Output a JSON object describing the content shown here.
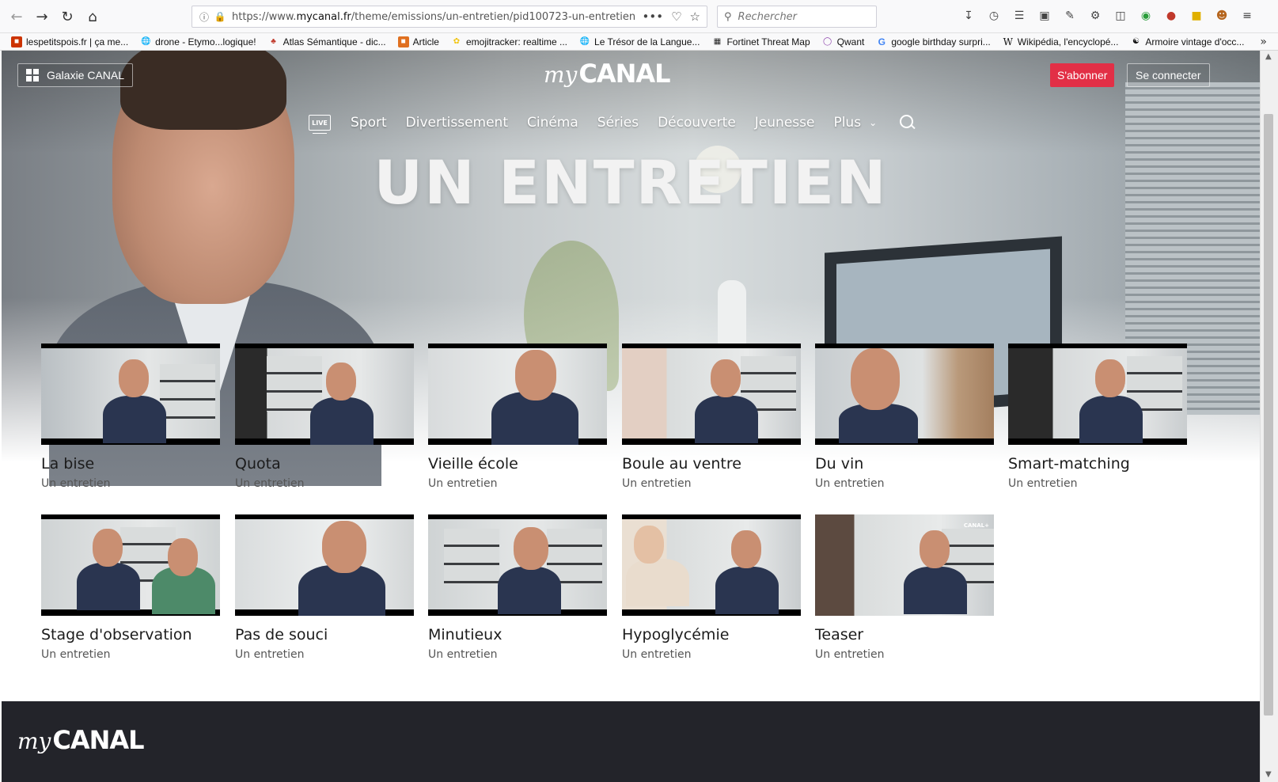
{
  "browser": {
    "url_prefix": "https://www.",
    "url_host": "mycanal.fr",
    "url_path": "/theme/emissions/un-entretien/pid100723-un-entretien",
    "search_placeholder": "Rechercher",
    "more_actions": "•••",
    "bookmarks": [
      {
        "label": "lespetitspois.fr | ça me...",
        "icon": "favicon-lespetitspois",
        "color": "#cc3300"
      },
      {
        "label": "drone - Etymo...logique!",
        "icon": "globe-icon",
        "color": "#444444"
      },
      {
        "label": "Atlas Sémantique - dic...",
        "icon": "favicon-atlas",
        "color": "#c0392b"
      },
      {
        "label": "Article",
        "icon": "favicon-article",
        "color": "#e07020"
      },
      {
        "label": "emojitracker: realtime ...",
        "icon": "favicon-emojitracker",
        "color": "#f1c40f"
      },
      {
        "label": "Le Trésor de la Langue...",
        "icon": "globe-icon",
        "color": "#444444"
      },
      {
        "label": "Fortinet Threat Map",
        "icon": "favicon-fortinet",
        "color": "#222222"
      },
      {
        "label": "Qwant",
        "icon": "favicon-qwant",
        "color": "#8e44ad"
      },
      {
        "label": "google birthday surpri...",
        "icon": "favicon-google",
        "color": "#4285f4"
      },
      {
        "label": "Wikipédia, l'encyclopé...",
        "icon": "favicon-wikipedia",
        "color": "#111111"
      },
      {
        "label": "Armoire vintage d'occ...",
        "icon": "favicon-armoire",
        "color": "#555555"
      }
    ]
  },
  "site": {
    "galaxie_label": "Galaxie CANAL",
    "logo_my": "my",
    "logo_canal": "CANAL",
    "subscribe_label": "S'abonner",
    "login_label": "Se connecter",
    "live_label": "LIVE",
    "nav": [
      "Sport",
      "Divertissement",
      "Cinéma",
      "Séries",
      "Découverte",
      "Jeunesse",
      "Plus"
    ],
    "hero_title": "UN ENTRETIEN",
    "accent_color": "#e22f46"
  },
  "episodes": [
    {
      "title": "La bise",
      "subtitle": "Un entretien"
    },
    {
      "title": "Quota",
      "subtitle": "Un entretien"
    },
    {
      "title": "Vieille école",
      "subtitle": "Un entretien"
    },
    {
      "title": "Boule au ventre",
      "subtitle": "Un entretien"
    },
    {
      "title": "Du vin",
      "subtitle": "Un entretien"
    },
    {
      "title": "Smart-matching",
      "subtitle": "Un entretien"
    },
    {
      "title": "Stage d'observation",
      "subtitle": "Un entretien"
    },
    {
      "title": "Pas de souci",
      "subtitle": "Un entretien"
    },
    {
      "title": "Minutieux",
      "subtitle": "Un entretien"
    },
    {
      "title": "Hypoglycémie",
      "subtitle": "Un entretien"
    },
    {
      "title": "Teaser",
      "subtitle": "Un entretien",
      "badge": "CANAL+"
    }
  ],
  "footer": {
    "logo_my": "my",
    "logo_canal": "CANAL"
  }
}
